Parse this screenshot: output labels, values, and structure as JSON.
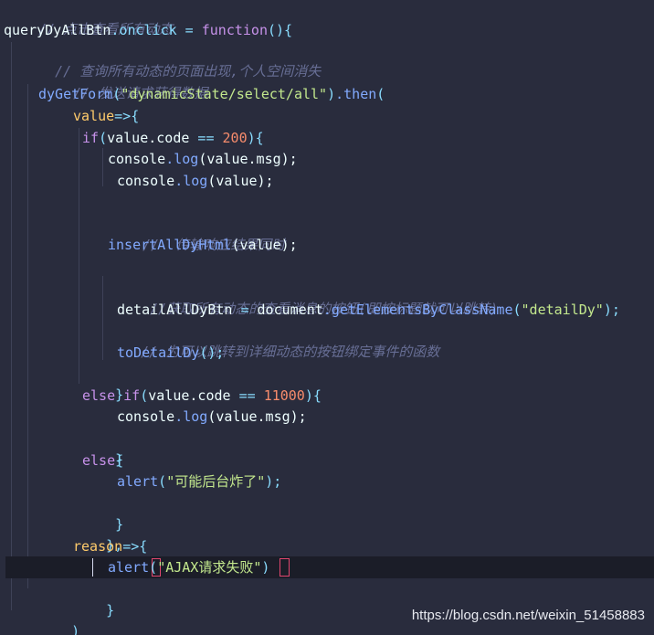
{
  "code": {
    "l1_comment": "// 点击查看所有动态",
    "l2_target": "queryDyAllBtn",
    "l2_prop": ".onclick",
    "l2_op": " = ",
    "l2_fn": "function",
    "l2_tail": "(){",
    "l3_comment": "// 查询所有动态的页面出现,个人空间消失",
    "l4_comment": "// 发送请求获得数据",
    "l5_call": "dyGetForm",
    "l5_open": "(",
    "l5_arg": "\"dynamicState/select/all\"",
    "l5_close": ")",
    "l5_then": ".then",
    "l5_paren": "(",
    "l6_param": "value",
    "l6_arrow": "=>{",
    "l7_if": "if",
    "l7_open": "(",
    "l7_expr": "value.code",
    "l7_eq": " == ",
    "l7_num": "200",
    "l7_close": "){",
    "l8_obj": "console",
    "l8_log": ".log",
    "l8_arg": "(value.msg);",
    "l9_obj": "console",
    "l9_log": ".log",
    "l9_arg": "(value);",
    "l10_comment": "//  传输响应结果同时",
    "l11_call": "insertAllDyHtml",
    "l11_arg": "(value);",
    "l12_comment": "//获取所有动态的查看消息的按钮(即按标题就可以跳转)",
    "l13_var": "detailAllDyBtn",
    "l13_op": " = ",
    "l13_obj": "document",
    "l13_method": ".getElementsByClassName",
    "l13_open": "(",
    "l13_arg": "\"detailDy\"",
    "l13_close": ");",
    "l14_comment": "// 为可以跳转到详细动态的按钮绑定事件的函数",
    "l15_call": "toDetailDy",
    "l15_tail": "();",
    "l16_brace": "}",
    "l17_else": "else",
    "l17_if": " if",
    "l17_open": "(",
    "l17_expr": "value.code",
    "l17_eq": " == ",
    "l17_num": "11000",
    "l17_close": "){",
    "l18_obj": "console",
    "l18_log": ".log",
    "l18_arg": "(value.msg);",
    "l19_brace": "}",
    "l20_else": "else",
    "l20_brace": "{",
    "l21_call": "alert",
    "l21_open": "(",
    "l21_arg": "\"可能后台炸了\"",
    "l21_close": ");",
    "l22_brace": "}",
    "l23_brace": "},",
    "l24_param": "reason",
    "l24_arrow": "=>{",
    "l25_call": "alert",
    "l25_open": "(",
    "l25_arg": "\"AJAX请求失败\"",
    "l25_close": ")",
    "l26_brace": "}",
    "l27_brace": ")",
    "l28_brace": "}"
  },
  "watermark": "https://blog.csdn.net/weixin_51458883",
  "colors": {
    "background": "#292c3d",
    "comment": "#676e95",
    "keyword": "#c792ea",
    "function": "#82aaff",
    "string": "#c3e88d",
    "number": "#f78c6c",
    "punctuation": "#89ddff",
    "parameter": "#ffcb6b",
    "bracket_match": "#e0466e"
  }
}
